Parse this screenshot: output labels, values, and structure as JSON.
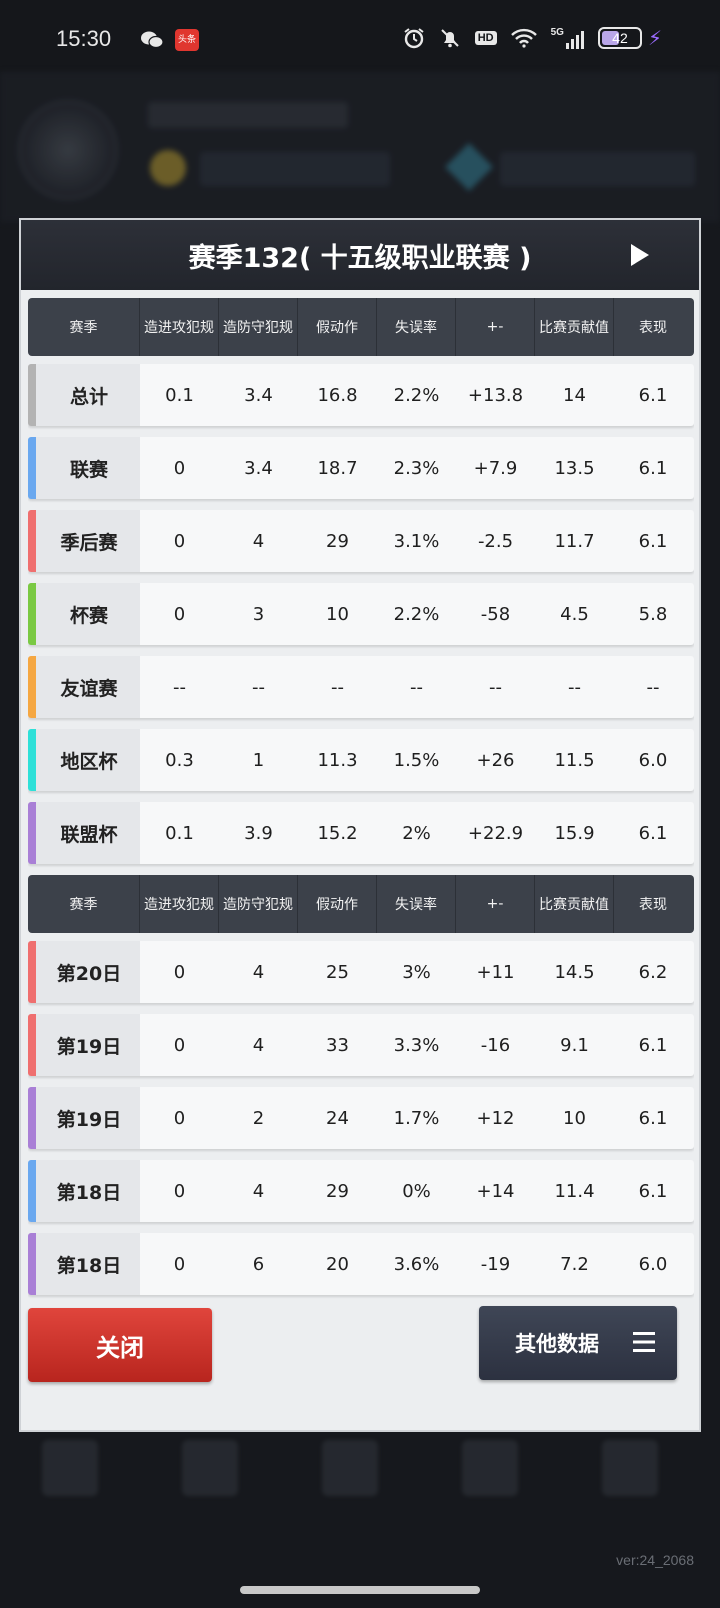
{
  "status_bar": {
    "time": "15:30",
    "toutiao_label": "头条",
    "hd_label": "HD",
    "network_label": "5G",
    "battery": "42"
  },
  "dialog": {
    "title": "赛季132( 十五级职业联赛 )",
    "columns": [
      "赛季",
      "造进攻犯规",
      "造防守犯规",
      "假动作",
      "失误率",
      "+-",
      "比赛贡献值",
      "表现"
    ],
    "summary_rows": [
      {
        "label": "总计",
        "accent": "#b3b3b3",
        "values": [
          "0.1",
          "3.4",
          "16.8",
          "2.2%",
          "+13.8",
          "14",
          "6.1"
        ]
      },
      {
        "label": "联赛",
        "accent": "#6aa8ef",
        "values": [
          "0",
          "3.4",
          "18.7",
          "2.3%",
          "+7.9",
          "13.5",
          "6.1"
        ]
      },
      {
        "label": "季后赛",
        "accent": "#ef6f6f",
        "values": [
          "0",
          "4",
          "29",
          "3.1%",
          "-2.5",
          "11.7",
          "6.1"
        ]
      },
      {
        "label": "杯赛",
        "accent": "#7ac943",
        "values": [
          "0",
          "3",
          "10",
          "2.2%",
          "-58",
          "4.5",
          "5.8"
        ]
      },
      {
        "label": "友谊赛",
        "accent": "#f5a742",
        "values": [
          "--",
          "--",
          "--",
          "--",
          "--",
          "--",
          "--"
        ]
      },
      {
        "label": "地区杯",
        "accent": "#2ee0d8",
        "values": [
          "0.3",
          "1",
          "11.3",
          "1.5%",
          "+26",
          "11.5",
          "6.0"
        ]
      },
      {
        "label": "联盟杯",
        "accent": "#a97fd6",
        "values": [
          "0.1",
          "3.9",
          "15.2",
          "2%",
          "+22.9",
          "15.9",
          "6.1"
        ]
      }
    ],
    "game_rows": [
      {
        "label": "第20日",
        "accent": "#ef6f6f",
        "values": [
          "0",
          "4",
          "25",
          "3%",
          "+11",
          "14.5",
          "6.2"
        ]
      },
      {
        "label": "第19日",
        "accent": "#ef6f6f",
        "values": [
          "0",
          "4",
          "33",
          "3.3%",
          "-16",
          "9.1",
          "6.1"
        ]
      },
      {
        "label": "第19日",
        "accent": "#a97fd6",
        "values": [
          "0",
          "2",
          "24",
          "1.7%",
          "+12",
          "10",
          "6.1"
        ]
      },
      {
        "label": "第18日",
        "accent": "#6aa8ef",
        "values": [
          "0",
          "4",
          "29",
          "0%",
          "+14",
          "11.4",
          "6.1"
        ]
      },
      {
        "label": "第18日",
        "accent": "#a97fd6",
        "values": [
          "0",
          "6",
          "20",
          "3.6%",
          "-19",
          "7.2",
          "6.0"
        ]
      }
    ],
    "close_label": "关闭",
    "other_data_label": "其他数据"
  },
  "version": "ver:24_2068"
}
